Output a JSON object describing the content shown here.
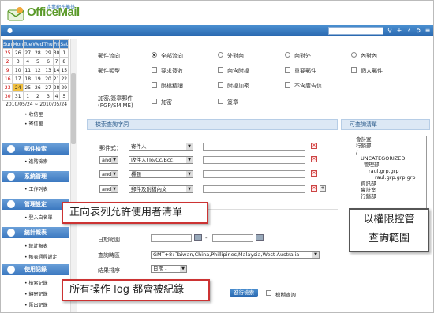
{
  "logo": {
    "cn": "企業郵件備份",
    "en": "OfficeMail"
  },
  "calendar": {
    "headers": [
      "Sun",
      "Mon",
      "Tue",
      "Wed",
      "Thu",
      "Fri",
      "Sat"
    ],
    "rows": [
      [
        "25",
        "26",
        "27",
        "28",
        "29",
        "30",
        "1"
      ],
      [
        "2",
        "3",
        "4",
        "5",
        "6",
        "7",
        "8"
      ],
      [
        "9",
        "10",
        "11",
        "12",
        "13",
        "14",
        "15"
      ],
      [
        "16",
        "17",
        "18",
        "19",
        "20",
        "21",
        "22"
      ],
      [
        "23",
        "24",
        "25",
        "26",
        "27",
        "28",
        "29"
      ],
      [
        "30",
        "31",
        "1",
        "2",
        "3",
        "4",
        "5"
      ]
    ],
    "range": "2010/05/24 ~ 2010/05/24"
  },
  "sidebar": {
    "top_items": [
      "收信匣",
      "寄信匣"
    ],
    "sections": [
      {
        "title": "郵件檢索",
        "items": [
          "進階檢索"
        ]
      },
      {
        "title": "系統管理",
        "items": [
          "工作列表"
        ]
      },
      {
        "title": "管理設定",
        "items": [
          "登入白名單"
        ]
      },
      {
        "title": "統計報表",
        "items": [
          "統計報表",
          "帳表週程設定"
        ]
      },
      {
        "title": "使用記錄",
        "items": [
          "檢索記錄",
          "轉寄記錄",
          "匯出記錄"
        ]
      }
    ]
  },
  "form": {
    "direction_label": "郵件流向",
    "direction_options": [
      "全部流向",
      "外對內",
      "內對外",
      "內對內"
    ],
    "type_label": "郵件類型",
    "type_options": [
      "要求簽收",
      "內含附檔",
      "重要郵件",
      "個人郵件",
      "附檔精讀",
      "附檔加密",
      "不含廣告信"
    ],
    "encrypt_label": "加密/簽章郵件",
    "encrypt_label2": "(PGP/SMIME)",
    "encrypt_options": [
      "加密",
      "簽章"
    ]
  },
  "query_panel": {
    "title": "檢索查詢字詞",
    "formula_label": "郵件式：",
    "rows": [
      {
        "logic": "",
        "field": "寄件人"
      },
      {
        "logic": "and",
        "field": "收件人(To/Cc/Bcc)"
      },
      {
        "logic": "and",
        "field": "標題"
      },
      {
        "logic": "and",
        "field": "郵件及附檔內文"
      }
    ]
  },
  "list_panel": {
    "title": "可查詢清單",
    "items": [
      "會計室",
      "行銷部",
      "/",
      "UNCATEGORIZED",
      "管理部",
      "raul.grp.grp",
      "raul.grp.grp.grp",
      "資訊部",
      "會計室",
      "行銷部"
    ]
  },
  "date_section": {
    "range_label": "日期範圍",
    "tz_label": "查詢時區",
    "tz_value": "GMT+8: Taiwan,China,Phillipines,Malaysia,West Australia",
    "sort_label": "結果排序",
    "sort_value": "日期 -",
    "dash": "-"
  },
  "actions": {
    "search_button": "進行檢索",
    "fuzzy_label": "模糊查詢"
  },
  "callouts": {
    "whitelist": "正向表列允許使用者清單",
    "permission_line1": "以權限控管",
    "permission_line2": "查詢範圍",
    "log": "所有操作 log 都會被紀錄"
  },
  "colors": {
    "accent": "#2a68b0",
    "brand_green": "#5b9a2a",
    "callout_red": "#cc3333"
  }
}
